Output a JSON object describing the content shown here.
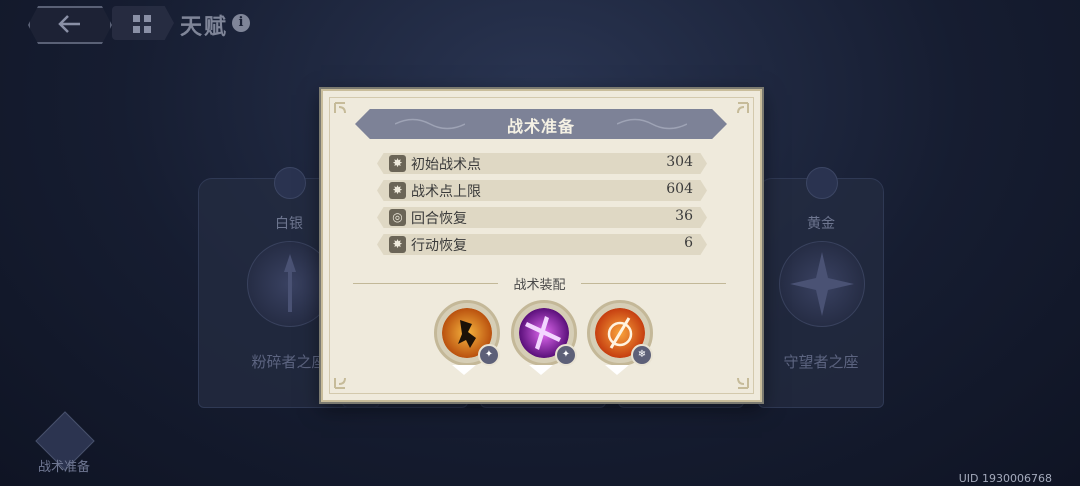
{
  "top_bar": {
    "title": "天赋",
    "info_glyph": "i"
  },
  "side_cards": {
    "left": {
      "rank": "白银",
      "name": "粉碎者之座"
    },
    "right": {
      "rank": "黄金",
      "name": "守望者之座"
    }
  },
  "bottom_left": {
    "label": "战术准备"
  },
  "uid": "UID 1930006768",
  "dialog": {
    "title": "战术准备",
    "stats": [
      {
        "label": "初始战术点",
        "value": "304",
        "icon": "tactic-point-icon"
      },
      {
        "label": "战术点上限",
        "value": "604",
        "icon": "tactic-cap-icon"
      },
      {
        "label": "回合恢复",
        "value": "36",
        "icon": "round-recover-icon"
      },
      {
        "label": "行动恢复",
        "value": "6",
        "icon": "action-recover-icon"
      }
    ],
    "section_title": "战术装配",
    "skills": [
      {
        "name": "dash-strike-skill-icon",
        "badge": "✦",
        "color": "#e8821c"
      },
      {
        "name": "blade-slash-skill-icon",
        "badge": "✦",
        "color": "#a524b8"
      },
      {
        "name": "flame-sword-skill-icon",
        "badge": "❄",
        "color": "#e9661e"
      }
    ]
  }
}
